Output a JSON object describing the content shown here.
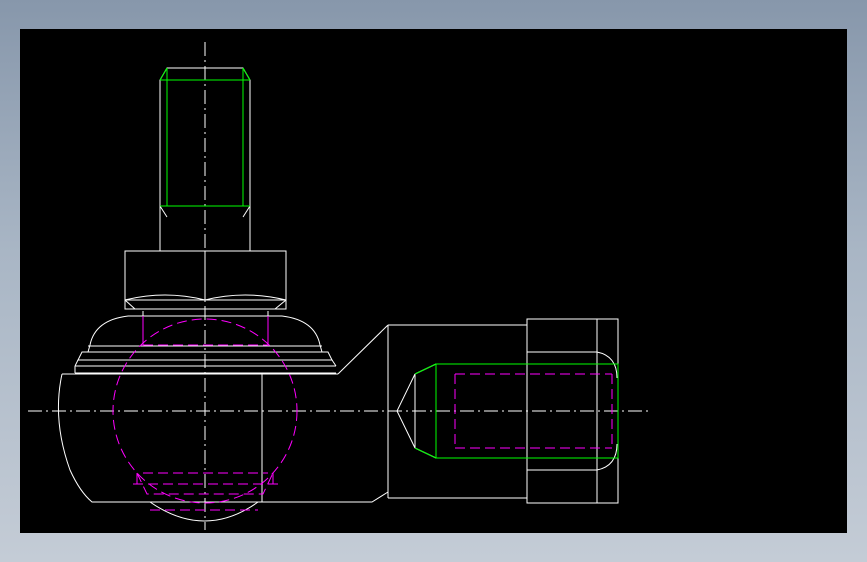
{
  "viewport": {
    "background": "#000000",
    "frame_gradient": [
      "#8797ab",
      "#c4ccd6"
    ]
  },
  "drawing": {
    "subject": "",
    "line_colors": {
      "outline": "#ffffff",
      "thread": "#00ff00",
      "hidden": "#ff00ff",
      "centerline": "#ffffff"
    }
  }
}
